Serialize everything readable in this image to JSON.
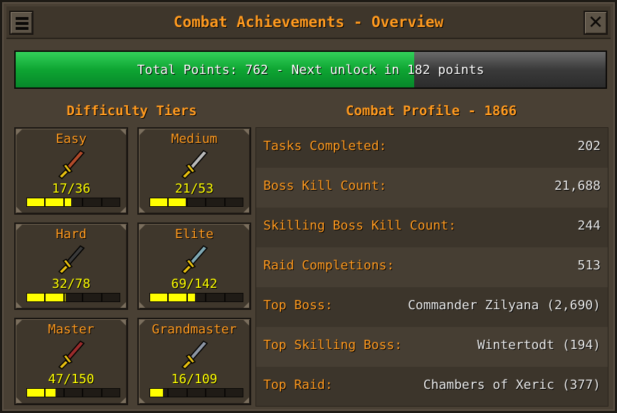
{
  "window": {
    "title": "Combat Achievements - Overview",
    "menu_icon": "hamburger-menu-icon",
    "close_icon": "close-x-icon"
  },
  "progress": {
    "text": "Total Points: 762 - Next unlock in 182 points",
    "fraction": 0.675,
    "fill_color": "#0ea532"
  },
  "tiers_section": {
    "title": "Difficulty Tiers",
    "tiers": [
      {
        "name": "Easy",
        "count": "17/36",
        "fraction": 0.472,
        "sword_color": "#b14a2a",
        "icon": "bronze-sword-icon"
      },
      {
        "name": "Medium",
        "count": "21/53",
        "fraction": 0.396,
        "sword_color": "#b9b9b9",
        "icon": "iron-sword-icon"
      },
      {
        "name": "Hard",
        "count": "32/78",
        "fraction": 0.41,
        "sword_color": "#3a3a3a",
        "icon": "black-sword-icon"
      },
      {
        "name": "Elite",
        "count": "69/142",
        "fraction": 0.486,
        "sword_color": "#7fa8b3",
        "icon": "rune-sword-icon"
      },
      {
        "name": "Master",
        "count": "47/150",
        "fraction": 0.313,
        "sword_color": "#9a2b2b",
        "icon": "dragon-sword-icon"
      },
      {
        "name": "Grandmaster",
        "count": "16/109",
        "fraction": 0.147,
        "sword_color": "#8c95a3",
        "icon": "blessed-sword-icon"
      }
    ]
  },
  "profile": {
    "title": "Combat Profile - 1866",
    "rows": [
      {
        "label": "Tasks Completed:",
        "value": "202"
      },
      {
        "label": "Boss Kill Count:",
        "value": "21,688"
      },
      {
        "label": "Skilling Boss Kill Count:",
        "value": "244"
      },
      {
        "label": "Raid Completions:",
        "value": "513"
      },
      {
        "label": "Top Boss:",
        "value": "Commander Zilyana (2,690)"
      },
      {
        "label": "Top Skilling Boss:",
        "value": "Wintertodt (194)"
      },
      {
        "label": "Top Raid:",
        "value": "Chambers of Xeric (377)"
      }
    ]
  }
}
